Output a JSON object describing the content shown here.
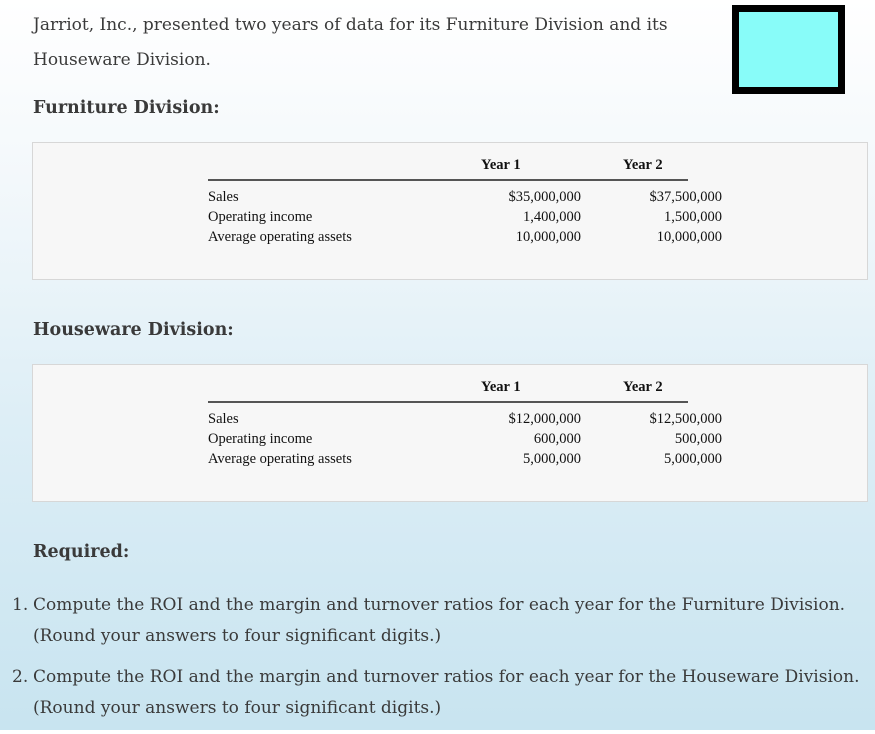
{
  "intro": "Jarriot, Inc., presented two years of data for its Furniture Division and its Houseware Division.",
  "colors": {
    "teal_box": "#88fcf9",
    "box_border": "#000000"
  },
  "furniture": {
    "heading": "Furniture Division:",
    "col_year1": "Year 1",
    "col_year2": "Year 2",
    "rows": [
      {
        "label": "Sales",
        "year1": "$35,000,000",
        "year2": "$37,500,000"
      },
      {
        "label": "Operating income",
        "year1": "1,400,000",
        "year2": "1,500,000"
      },
      {
        "label": "Average operating assets",
        "year1": "10,000,000",
        "year2": "10,000,000"
      }
    ]
  },
  "houseware": {
    "heading": "Houseware Division:",
    "col_year1": "Year 1",
    "col_year2": "Year 2",
    "rows": [
      {
        "label": "Sales",
        "year1": "$12,000,000",
        "year2": "$12,500,000"
      },
      {
        "label": "Operating income",
        "year1": "600,000",
        "year2": "500,000"
      },
      {
        "label": "Average operating assets",
        "year1": "5,000,000",
        "year2": "5,000,000"
      }
    ]
  },
  "required": {
    "heading": "Required:",
    "items": [
      {
        "num": "1.",
        "text": "Compute the ROI and the margin and turnover ratios for each year for the Furniture Division. (Round your answers to four significant digits.)"
      },
      {
        "num": "2.",
        "text": "Compute the ROI and the margin and turnover ratios for each year for the Houseware Division. (Round your answers to four significant digits.)"
      }
    ]
  }
}
